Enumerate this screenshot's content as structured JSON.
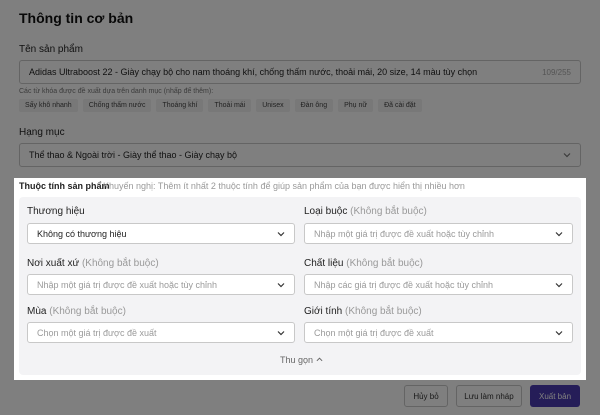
{
  "section_title": "Thông tin cơ bản",
  "product_name": {
    "label": "Tên sản phẩm",
    "value": "Adidas Ultraboost 22 - Giày chạy bộ cho nam thoáng khí, chống thấm nước, thoải mái, 20 size, 14 màu tùy chọn",
    "counter": "109/255"
  },
  "keywords": {
    "hint": "Các từ khóa được đề xuất dựa trên danh mục (nhấp để thêm):",
    "tags": [
      "Sấy khô nhanh",
      "Chống thấm nước",
      "Thoáng khí",
      "Thoải mái",
      "Unisex",
      "Đàn ông",
      "Phụ nữ",
      "Đã cài đặt"
    ]
  },
  "category": {
    "label": "Hạng mục",
    "value": "Thể thao & Ngoài trời - Giày thể thao - Giày chạy bộ"
  },
  "attributes": {
    "title": "Thuộc tính sản phẩm",
    "hint": "Khuyến nghị: Thêm ít nhất 2 thuộc tính để giúp sản phẩm của bạn được hiển thị nhiều hơn",
    "brand": {
      "label": "Thương hiệu",
      "value": "Không có thương hiệu"
    },
    "lace_type": {
      "label": "Loại buộc",
      "optional": "(Không bắt buộc)",
      "placeholder": "Nhập một giá trị được đề xuất hoặc tùy chỉnh"
    },
    "origin": {
      "label": "Nơi xuất xứ",
      "optional": "(Không bắt buộc)",
      "placeholder": "Nhập một giá trị được đề xuất hoặc tùy chỉnh"
    },
    "material": {
      "label": "Chất liệu",
      "optional": "(Không bắt buộc)",
      "placeholder": "Nhập các giá trị được đề xuất hoặc tùy chỉnh"
    },
    "season": {
      "label": "Mùa",
      "optional": "(Không bắt buộc)",
      "placeholder": "Chọn một giá trị được đề xuất"
    },
    "gender": {
      "label": "Giới tính",
      "optional": "(Không bắt buộc)",
      "placeholder": "Chọn một giá trị được đề xuất"
    },
    "collapse": "Thu gọn"
  },
  "footer": {
    "cancel": "Hủy bỏ",
    "save_draft": "Lưu làm nháp",
    "publish": "Xuất bản"
  },
  "colors": {
    "primary": "#4b3ab0"
  }
}
